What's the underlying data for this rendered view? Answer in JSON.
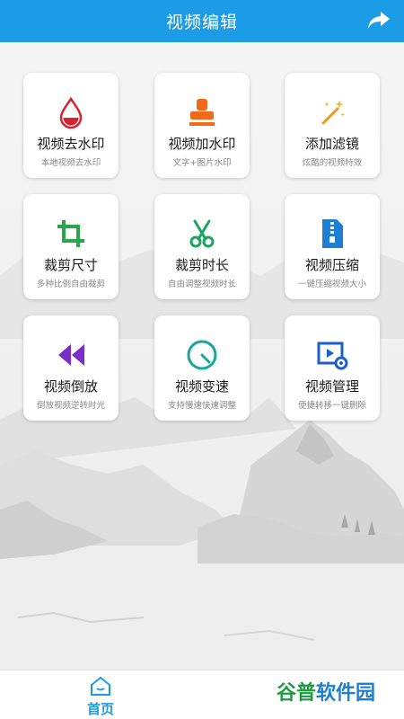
{
  "header": {
    "title": "视频编辑",
    "share_icon": "share-icon"
  },
  "cards": [
    {
      "label": "视频去水印",
      "sub": "本地视频去水印",
      "icon": "drop-icon"
    },
    {
      "label": "视频加水印",
      "sub": "文字+图片水印",
      "icon": "stamp-icon"
    },
    {
      "label": "添加滤镜",
      "sub": "炫酷的视频特效",
      "icon": "magic-wand-icon"
    },
    {
      "label": "裁剪尺寸",
      "sub": "多种比例自由裁剪",
      "icon": "crop-icon"
    },
    {
      "label": "裁剪时长",
      "sub": "自由调整视频时长",
      "icon": "scissors-icon"
    },
    {
      "label": "视频压缩",
      "sub": "一键压缩视频大小",
      "icon": "zip-icon"
    },
    {
      "label": "视频倒放",
      "sub": "倒放视频逆转时光",
      "icon": "rewind-icon"
    },
    {
      "label": "视频变速",
      "sub": "支持慢速快速调整",
      "icon": "speedometer-icon"
    },
    {
      "label": "视频管理",
      "sub": "便捷转移一键删除",
      "icon": "video-settings-icon"
    }
  ],
  "tabbar": {
    "home_label": "首页",
    "home_icon": "home-icon"
  },
  "watermark": {
    "part1": "谷普",
    "part2": "软件园"
  },
  "colors": {
    "primary": "#1c9be6",
    "red": "#d9232f",
    "orange": "#f06a1a",
    "green": "#2aa64a",
    "teal": "#1aa5a0",
    "purple": "#7b2fc9",
    "blue": "#1c7fd4"
  }
}
